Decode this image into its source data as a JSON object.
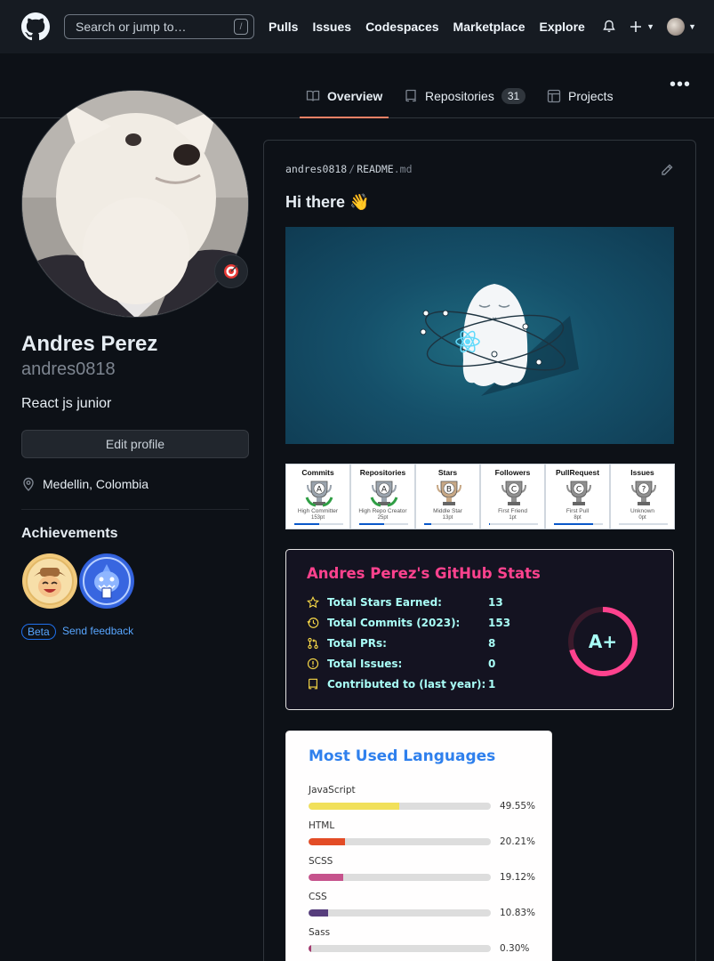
{
  "header": {
    "search_placeholder": "Search or jump to…",
    "search_shortcut": "/",
    "nav": [
      "Pulls",
      "Issues",
      "Codespaces",
      "Marketplace",
      "Explore"
    ]
  },
  "tabs": [
    {
      "label": "Overview",
      "icon": "book-icon",
      "active": true
    },
    {
      "label": "Repositories",
      "icon": "repo-icon",
      "count": "31"
    },
    {
      "label": "Projects",
      "icon": "table-icon"
    }
  ],
  "profile": {
    "name": "Andres Perez",
    "login": "andres0818",
    "bio": "React js junior",
    "edit_button": "Edit profile",
    "location": "Medellin, Colombia",
    "status_emoji": "🎯"
  },
  "achievements": {
    "title": "Achievements",
    "items": [
      "achievement-cowboy-icon",
      "achievement-shark-icon"
    ],
    "beta_label": "Beta",
    "feedback_link": "Send feedback"
  },
  "readme": {
    "owner": "andres0818",
    "separator": "/",
    "file": "README",
    "ext": ".md",
    "heading": "Hi there 👋"
  },
  "trophies": [
    {
      "title": "Commits",
      "rank": "A",
      "name": "High Committer",
      "points": "153pt",
      "progress": 0.5,
      "color": "#9aa3ad"
    },
    {
      "title": "Repositories",
      "rank": "A",
      "name": "High Repo Creator",
      "points": "25pt",
      "progress": 0.5,
      "color": "#9aa3ad"
    },
    {
      "title": "Stars",
      "rank": "B",
      "name": "Middle Star",
      "points": "13pt",
      "progress": 0.15,
      "color": "#c7a886"
    },
    {
      "title": "Followers",
      "rank": "C",
      "name": "First Friend",
      "points": "1pt",
      "progress": 0.02,
      "color": "#8f8f8f"
    },
    {
      "title": "PullRequest",
      "rank": "C",
      "name": "First Pull",
      "points": "8pt",
      "progress": 0.8,
      "color": "#8f8f8f"
    },
    {
      "title": "Issues",
      "rank": "?",
      "name": "Unknown",
      "points": "0pt",
      "progress": 0.0,
      "color": "#8f8f8f"
    }
  ],
  "stats": {
    "title": "Andres Perez's GitHub Stats",
    "rows": [
      {
        "icon": "star-icon",
        "label": "Total Stars Earned:",
        "value": "13"
      },
      {
        "icon": "history-icon",
        "label": "Total Commits (2023):",
        "value": "153"
      },
      {
        "icon": "pull-request-icon",
        "label": "Total PRs:",
        "value": "8"
      },
      {
        "icon": "issue-icon",
        "label": "Total Issues:",
        "value": "0"
      },
      {
        "icon": "repo-icon",
        "label": "Contributed to (last year):",
        "value": "1"
      }
    ],
    "grade": "A+",
    "colors": {
      "title": "#fe428e",
      "text": "#a9fef7",
      "icon": "#f8d847",
      "ring": "#fe428e",
      "bg": "#141321"
    }
  },
  "languages": {
    "title": "Most Used Languages",
    "items": [
      {
        "name": "JavaScript",
        "percent": "49.55%",
        "value": 49.55,
        "color": "#f1e05a"
      },
      {
        "name": "HTML",
        "percent": "20.21%",
        "value": 20.21,
        "color": "#e34c26"
      },
      {
        "name": "SCSS",
        "percent": "19.12%",
        "value": 19.12,
        "color": "#c6538c"
      },
      {
        "name": "CSS",
        "percent": "10.83%",
        "value": 10.83,
        "color": "#563d7c"
      },
      {
        "name": "Sass",
        "percent": "0.30%",
        "value": 0.3,
        "color": "#a53b70"
      }
    ]
  }
}
